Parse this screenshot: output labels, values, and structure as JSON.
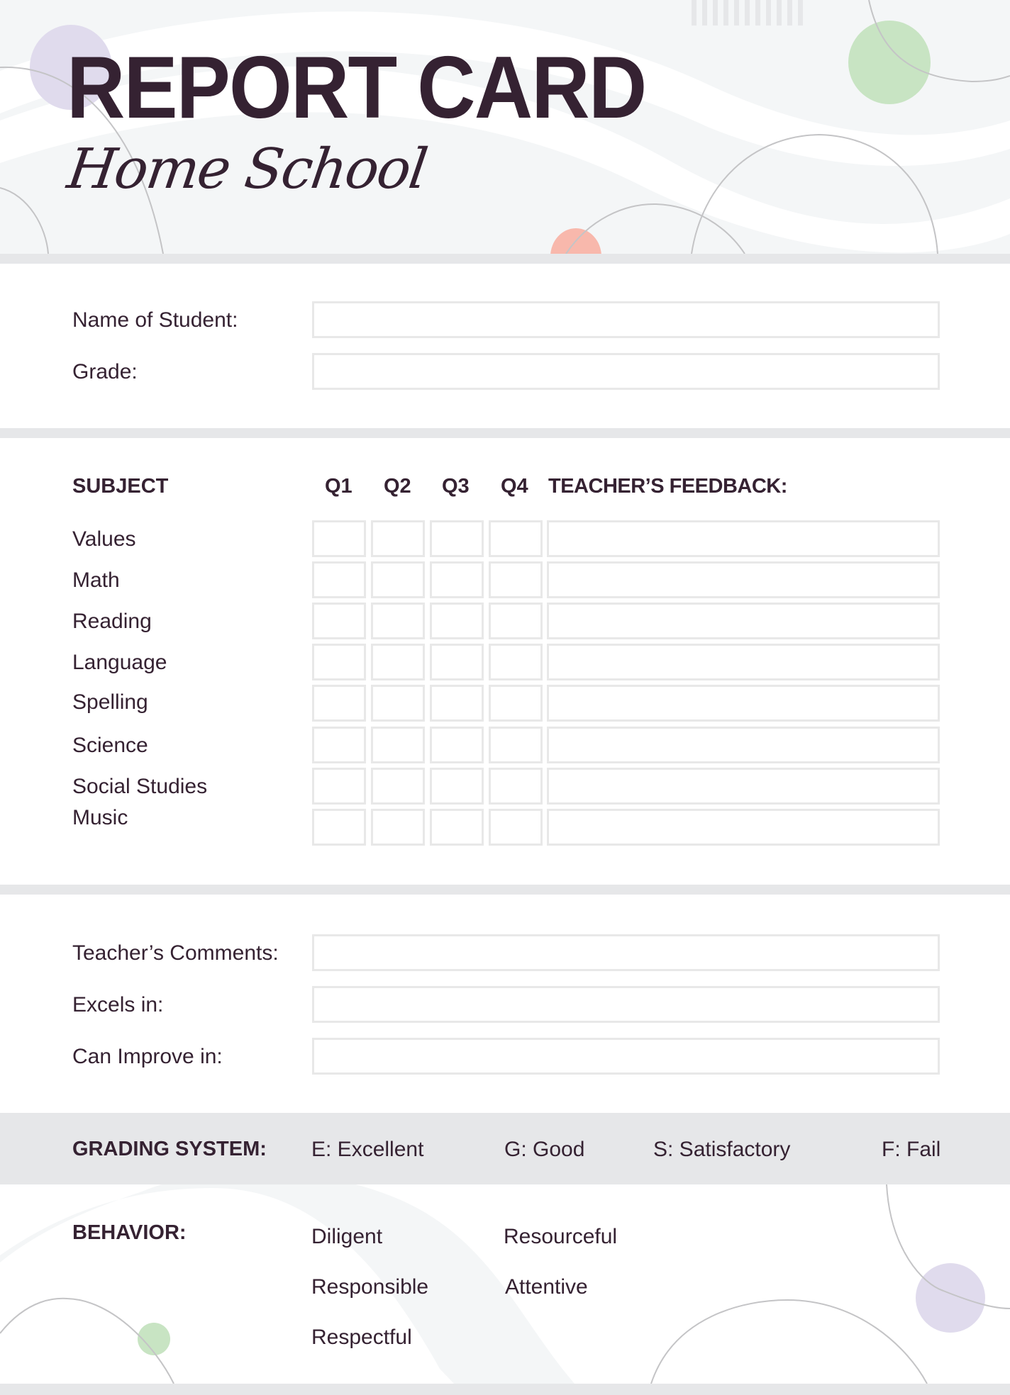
{
  "header": {
    "title": "REPORT CARD",
    "subtitle": "Home School"
  },
  "student_info": {
    "fields": [
      {
        "label": "Name of Student:",
        "value": ""
      },
      {
        "label": "Grade:",
        "value": ""
      }
    ]
  },
  "subjects_table": {
    "headers": {
      "subject": "SUBJECT",
      "quarters": [
        "Q1",
        "Q2",
        "Q3",
        "Q4"
      ],
      "feedback": "TEACHER’S FEEDBACK:"
    },
    "rows": [
      {
        "subject": "Values",
        "q1": "",
        "q2": "",
        "q3": "",
        "q4": "",
        "feedback": ""
      },
      {
        "subject": "Math",
        "q1": "",
        "q2": "",
        "q3": "",
        "q4": "",
        "feedback": ""
      },
      {
        "subject": "Reading",
        "q1": "",
        "q2": "",
        "q3": "",
        "q4": "",
        "feedback": ""
      },
      {
        "subject": "Language",
        "q1": "",
        "q2": "",
        "q3": "",
        "q4": "",
        "feedback": ""
      },
      {
        "subject": "Spelling",
        "q1": "",
        "q2": "",
        "q3": "",
        "q4": "",
        "feedback": ""
      },
      {
        "subject": "Science",
        "q1": "",
        "q2": "",
        "q3": "",
        "q4": "",
        "feedback": ""
      },
      {
        "subject": "Social Studies",
        "q1": "",
        "q2": "",
        "q3": "",
        "q4": "",
        "feedback": ""
      },
      {
        "subject": "Music",
        "q1": "",
        "q2": "",
        "q3": "",
        "q4": "",
        "feedback": ""
      }
    ]
  },
  "comments": {
    "fields": [
      {
        "label": "Teacher’s Comments:",
        "value": ""
      },
      {
        "label": "Excels in:",
        "value": ""
      },
      {
        "label": "Can Improve in:",
        "value": ""
      }
    ]
  },
  "grading_system": {
    "label": "GRADING SYSTEM:",
    "grades": [
      "E: Excellent",
      "G: Good",
      "S: Satisfactory",
      "F: Fail"
    ]
  },
  "behavior": {
    "label": "BEHAVIOR:",
    "traits": [
      "Diligent",
      "Resourceful",
      "Responsible",
      "Attentive",
      "Respectful"
    ]
  },
  "colors": {
    "text": "#352232",
    "header_bg": "#f4f6f7",
    "divider": "#e6e7e9",
    "field_border": "#e8e8e8",
    "accent_lavender": "#e0dbed",
    "accent_green": "#c8e4c3",
    "accent_salmon": "#f8b8ac"
  }
}
